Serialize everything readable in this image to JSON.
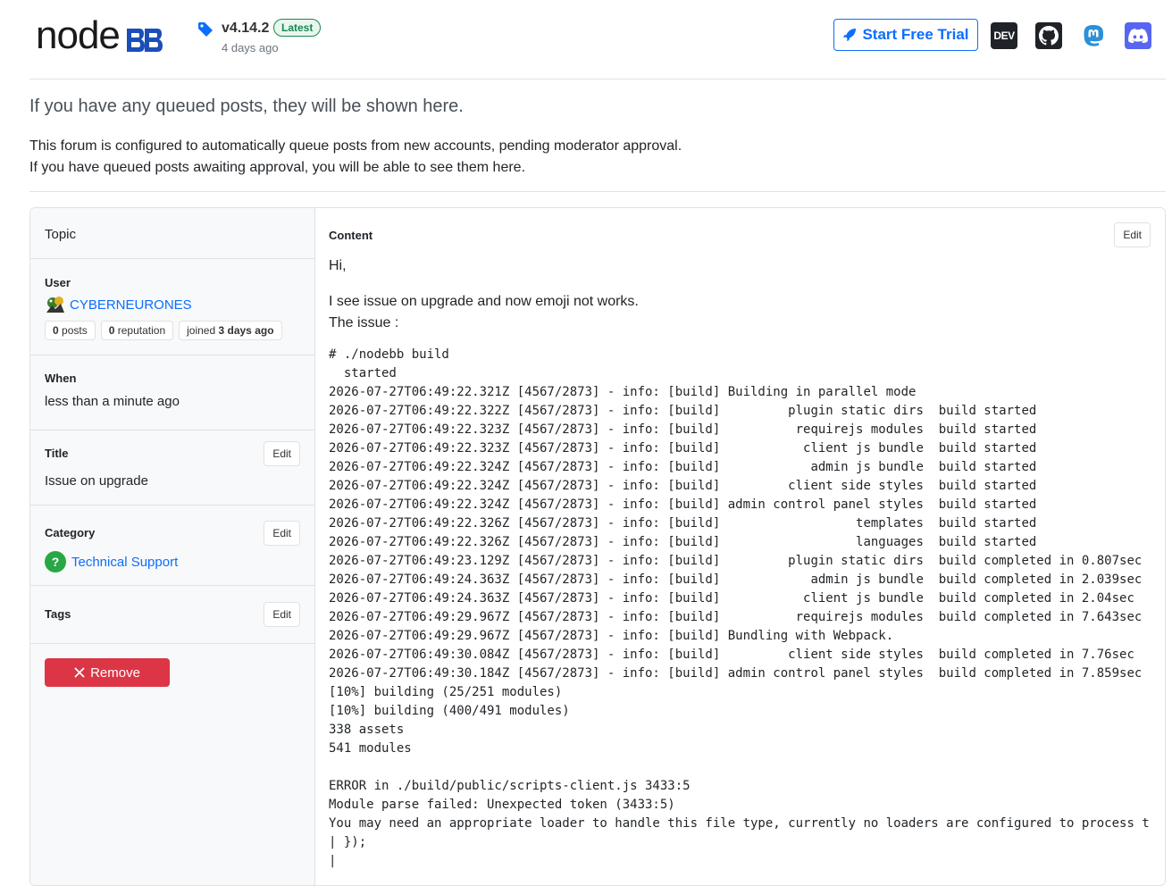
{
  "header": {
    "logo_text": "node",
    "version": "v4.14.2",
    "latest_label": "Latest",
    "released_ago": "4 days ago",
    "trial_label": "Start Free Trial",
    "dev_label": "DEV"
  },
  "notice": {
    "lead": "If you have any queued posts, they will be shown here.",
    "line1": "This forum is configured to automatically queue posts from new accounts, pending moderator approval.",
    "line2": "If you have queued posts awaiting approval, you will be able to see them here."
  },
  "queue": {
    "topic_label": "Topic",
    "user_label": "User",
    "username": "CYBERNEURONES",
    "posts_count": "0",
    "posts_label": "posts",
    "reputation_count": "0",
    "reputation_label": "reputation",
    "joined_label": "joined",
    "joined_value": "3 days ago",
    "when_label": "When",
    "when_value": "less than a minute ago",
    "title_label": "Title",
    "title_value": "Issue on upgrade",
    "category_label": "Category",
    "category_value": "Technical Support",
    "tags_label": "Tags",
    "edit_label": "Edit",
    "remove_label": "Remove",
    "content_label": "Content",
    "greeting": "Hi,",
    "body_line1": "I see issue on upgrade and now emoji not works.",
    "body_line2": "The issue :",
    "log": "# ./nodebb build\n  started\n2026-07-27T06:49:22.321Z [4567/2873] - info: [build] Building in parallel mode\n2026-07-27T06:49:22.322Z [4567/2873] - info: [build]         plugin static dirs  build started\n2026-07-27T06:49:22.323Z [4567/2873] - info: [build]          requirejs modules  build started\n2026-07-27T06:49:22.323Z [4567/2873] - info: [build]           client js bundle  build started\n2026-07-27T06:49:22.324Z [4567/2873] - info: [build]            admin js bundle  build started\n2026-07-27T06:49:22.324Z [4567/2873] - info: [build]         client side styles  build started\n2026-07-27T06:49:22.324Z [4567/2873] - info: [build] admin control panel styles  build started\n2026-07-27T06:49:22.326Z [4567/2873] - info: [build]                  templates  build started\n2026-07-27T06:49:22.326Z [4567/2873] - info: [build]                  languages  build started\n2026-07-27T06:49:23.129Z [4567/2873] - info: [build]         plugin static dirs  build completed in 0.807sec\n2026-07-27T06:49:24.363Z [4567/2873] - info: [build]            admin js bundle  build completed in 2.039sec\n2026-07-27T06:49:24.363Z [4567/2873] - info: [build]           client js bundle  build completed in 2.04sec\n2026-07-27T06:49:29.967Z [4567/2873] - info: [build]          requirejs modules  build completed in 7.643sec\n2026-07-27T06:49:29.967Z [4567/2873] - info: [build] Bundling with Webpack.\n2026-07-27T06:49:30.084Z [4567/2873] - info: [build]         client side styles  build completed in 7.76sec\n2026-07-27T06:49:30.184Z [4567/2873] - info: [build] admin control panel styles  build completed in 7.859sec\n[10%] building (25/251 modules)\n[10%] building (400/491 modules)\n338 assets\n541 modules\n\nERROR in ./build/public/scripts-client.js 3433:5\nModule parse failed: Unexpected token (3433:5)\nYou may need an appropriate loader to handle this file type, currently no loaders are configured to process this file.\n| });\n|"
  },
  "colors": {
    "primary": "#0d6efd",
    "danger": "#dc3545",
    "success": "#198754",
    "category": "#28a745",
    "discord": "#5865f2",
    "mastodon": "#6364ff"
  }
}
